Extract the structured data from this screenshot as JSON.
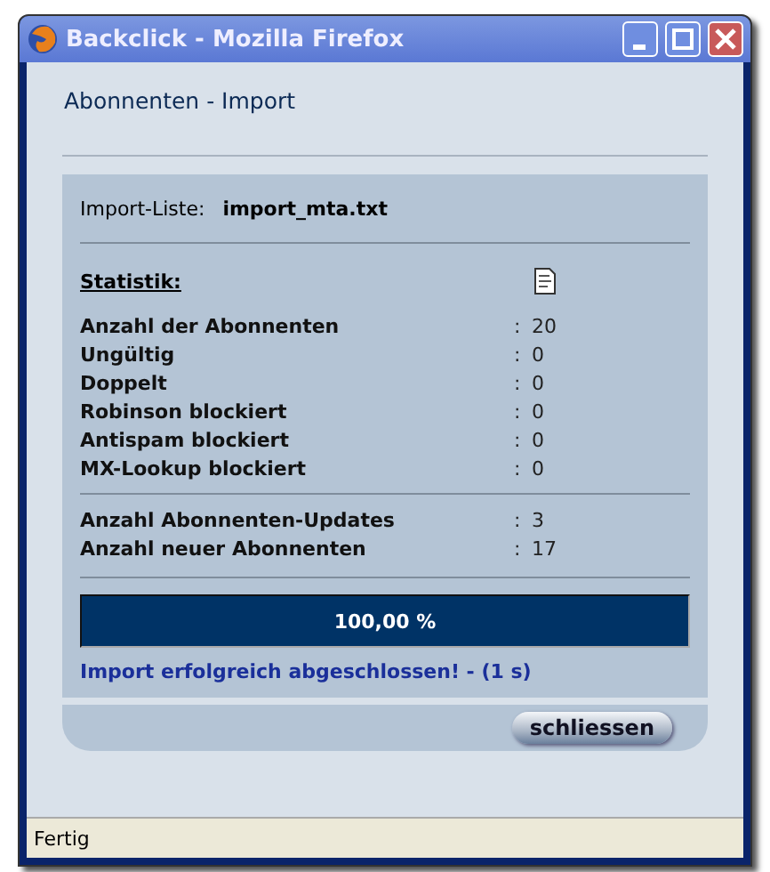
{
  "window": {
    "title": "Backclick - Mozilla Firefox"
  },
  "heading": "Abonnenten - Import",
  "import_list": {
    "label": "Import-Liste:",
    "value": "import_mta.txt"
  },
  "statistics": {
    "title": "Statistik:",
    "groups": [
      [
        {
          "label": "Anzahl der Abonnenten",
          "value": "20"
        },
        {
          "label": "Ungültig",
          "value": "0"
        },
        {
          "label": "Doppelt",
          "value": "0"
        },
        {
          "label": "Robinson blockiert",
          "value": "0"
        },
        {
          "label": "Antispam blockiert",
          "value": "0"
        },
        {
          "label": "MX-Lookup blockiert",
          "value": "0"
        }
      ],
      [
        {
          "label": "Anzahl Abonnenten-Updates",
          "value": "3"
        },
        {
          "label": "Anzahl neuer Abonnenten",
          "value": "17"
        }
      ]
    ]
  },
  "separator": ":",
  "progress": {
    "level": 1,
    "reading": "100,00 %"
  },
  "message": "Import erfolgreich abgeschlossen! - (1 s)",
  "close_button": "schliessen",
  "status_bar": "Fertig"
}
